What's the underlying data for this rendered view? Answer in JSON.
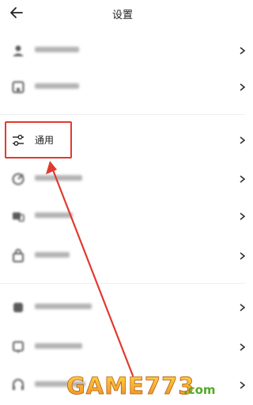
{
  "header": {
    "title": "设置",
    "back_icon": "arrow-left-icon"
  },
  "settings": {
    "general_label": "通用"
  },
  "icons": {
    "chevron": "chevron-right-icon"
  },
  "annotation": {
    "box_color": "#e03a2f",
    "arrow_color": "#e03a2f"
  },
  "watermark": {
    "text_game": "GAME773",
    "text_dotcom": ".com"
  }
}
